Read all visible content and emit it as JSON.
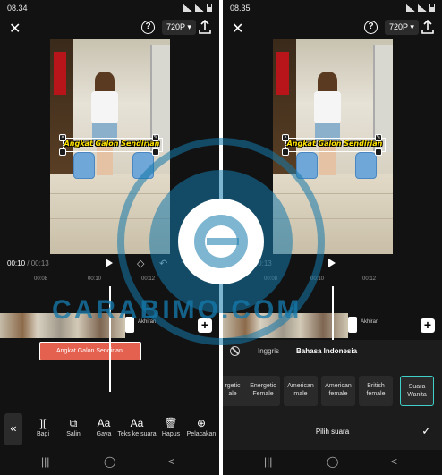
{
  "left": {
    "status": {
      "time": "08.34"
    },
    "topbar": {
      "close": "✕",
      "help": "?",
      "resolution": "720P ▾"
    },
    "preview": {
      "caption": "Angkat Galon Sendirian"
    },
    "timecode": {
      "current": "00:10",
      "total": " / 00:13"
    },
    "ruler": [
      "00:08",
      "00:10",
      "00:12"
    ],
    "track": {
      "end_label": "Akhiran",
      "text_clip": "Angkat Galon Sendirian"
    },
    "toolbar": {
      "collapse": "«",
      "tools": [
        {
          "icon": "][",
          "label": "Bagi"
        },
        {
          "icon": "⧉",
          "label": "Salin"
        },
        {
          "icon": "Aa",
          "label": "Gaya"
        },
        {
          "icon": "Aa",
          "label": "Teks ke suara"
        },
        {
          "icon": "🗑",
          "label": "Hapus"
        },
        {
          "icon": "⊕",
          "label": "Pelacakan"
        }
      ]
    }
  },
  "right": {
    "status": {
      "time": "08.35"
    },
    "topbar": {
      "close": "✕",
      "help": "?",
      "resolution": "720P ▾"
    },
    "preview": {
      "caption": "Angkat Galon Sendirian"
    },
    "timecode": {
      "current": "00:10",
      "total": " / 00:13"
    },
    "ruler": [
      "00:08",
      "00:10",
      "00:12"
    ],
    "track": {
      "end_label": "Akhiran"
    },
    "voice_panel": {
      "languages": [
        "Inggris",
        "Bahasa Indonesia"
      ],
      "voices": [
        {
          "line1": "rgetic",
          "line2": "ale"
        },
        {
          "line1": "Energetic",
          "line2": "Female"
        },
        {
          "line1": "American",
          "line2": "male"
        },
        {
          "line1": "American",
          "line2": "female"
        },
        {
          "line1": "British",
          "line2": "female"
        },
        {
          "line1": "Suara",
          "line2": "Wanita"
        }
      ],
      "choose_voice": "Pilih suara",
      "confirm": "✓"
    }
  },
  "watermark": "CARABIMO.COM",
  "nav": {
    "recents": "|||",
    "home": "◯",
    "back": "<"
  },
  "colors": {
    "accent": "#3fd0c9",
    "text_clip": "#e4604f",
    "caption": "#ffe400",
    "watermark": "#1478aa"
  }
}
